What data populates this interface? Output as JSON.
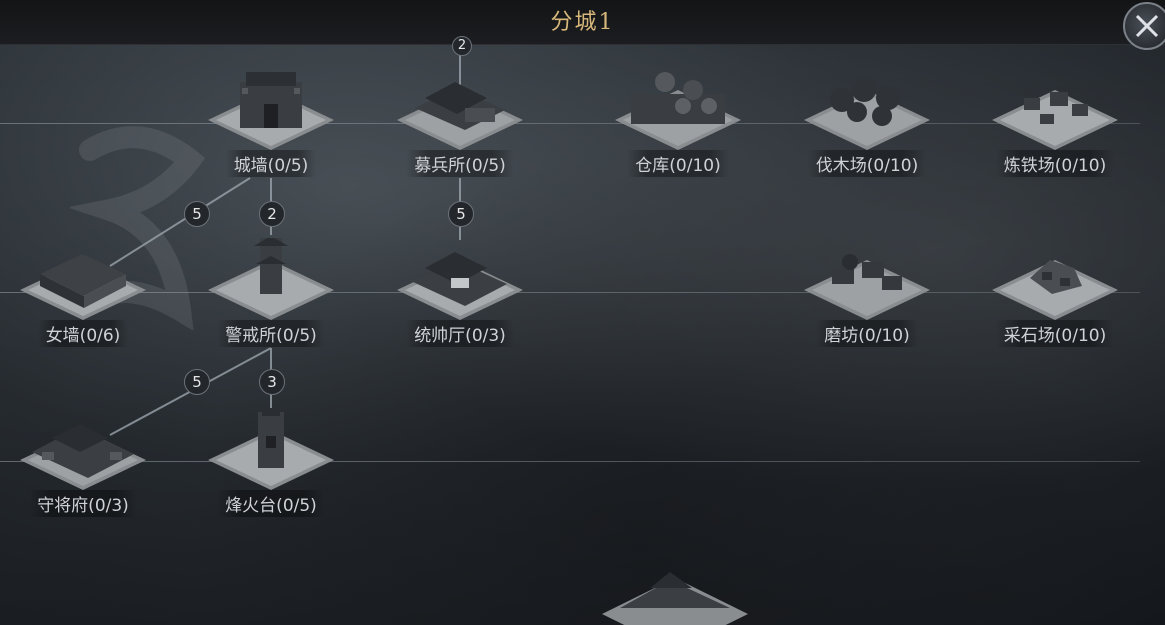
{
  "header": {
    "title": "分城1"
  },
  "buildings": {
    "chengqiang": "城墙(0/5)",
    "mubingsuo": "募兵所(0/5)",
    "cangku": "仓库(0/10)",
    "famuchang": "伐木场(0/10)",
    "liantiechang": "炼铁场(0/10)",
    "nvqiang": "女墙(0/6)",
    "jingjiesuo": "警戒所(0/5)",
    "tongshuaiting": "统帅厅(0/3)",
    "mofang": "磨坊(0/10)",
    "caishichang": "采石场(0/10)",
    "shoujiangfu": "守将府(0/3)",
    "fenghuotai": "烽火台(0/5)"
  },
  "requirements": {
    "top_mubing": "2",
    "chengqiang_to_nvqiang": "5",
    "chengqiang_to_jingjie": "2",
    "mubing_to_tongshuai": "5",
    "jingjie_to_shoujiang": "5",
    "jingjie_to_fenghuo": "3"
  },
  "colors": {
    "title": "#d8b87a",
    "label": "#cfd2d6"
  }
}
